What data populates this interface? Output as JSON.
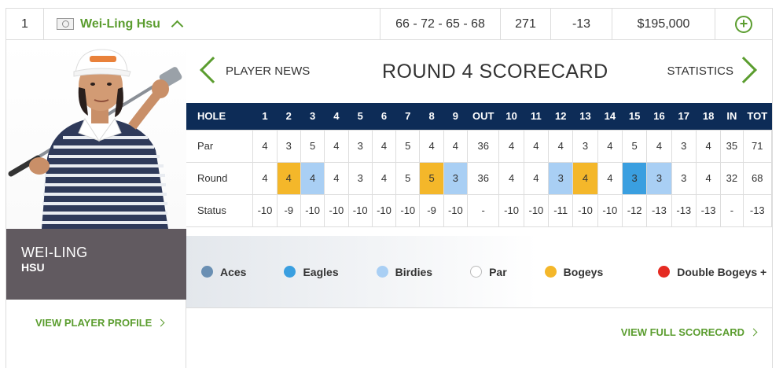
{
  "leaderboard_row": {
    "position": "1",
    "flag_icon": "country-flag-icon",
    "player_name": "Wei-Ling Hsu",
    "rounds": "66 - 72 - 65 - 68",
    "total": "271",
    "to_par": "-13",
    "earnings": "$195,000"
  },
  "player_card": {
    "first_name": "WEI-LING",
    "last_name": "HSU",
    "profile_link": "VIEW PLAYER PROFILE"
  },
  "scorecard": {
    "title": "ROUND 4 SCORECARD",
    "nav_left_label": "PLAYER NEWS",
    "nav_right_label": "STATISTICS",
    "full_link": "VIEW FULL SCORECARD",
    "headers": [
      "HOLE",
      "1",
      "2",
      "3",
      "4",
      "5",
      "6",
      "7",
      "8",
      "9",
      "OUT",
      "10",
      "11",
      "12",
      "13",
      "14",
      "15",
      "16",
      "17",
      "18",
      "IN",
      "TOT"
    ],
    "rows": [
      {
        "label": "Par",
        "cells": [
          "4",
          "3",
          "5",
          "4",
          "3",
          "4",
          "5",
          "4",
          "4",
          "36",
          "4",
          "4",
          "4",
          "3",
          "4",
          "5",
          "4",
          "3",
          "4",
          "35",
          "71"
        ]
      },
      {
        "label": "Round",
        "cells": [
          "4",
          "4",
          "4",
          "4",
          "3",
          "4",
          "5",
          "5",
          "3",
          "36",
          "4",
          "4",
          "3",
          "4",
          "4",
          "3",
          "3",
          "3",
          "4",
          "32",
          "68"
        ],
        "highlights": [
          "",
          "bogey",
          "birdie",
          "",
          "",
          "",
          "",
          "bogey",
          "birdie",
          "",
          "",
          "",
          "birdie",
          "bogey",
          "",
          "eagle",
          "birdie",
          "",
          "",
          "",
          ""
        ]
      },
      {
        "label": "Status",
        "cells": [
          "-10",
          "-9",
          "-10",
          "-10",
          "-10",
          "-10",
          "-10",
          "-9",
          "-10",
          "-",
          "-10",
          "-10",
          "-11",
          "-10",
          "-10",
          "-12",
          "-13",
          "-13",
          "-13",
          "-",
          "-13"
        ]
      }
    ],
    "legend": [
      {
        "label": "Aces",
        "color": "#6a8fb3"
      },
      {
        "label": "Eagles",
        "color": "#3a9fe0"
      },
      {
        "label": "Birdies",
        "color": "#a9cff4"
      },
      {
        "label": "Par",
        "color": "#ffffff"
      },
      {
        "label": "Bogeys",
        "color": "#f4b72a"
      },
      {
        "label": "Double Bogeys +",
        "color": "#e52b22"
      }
    ]
  }
}
